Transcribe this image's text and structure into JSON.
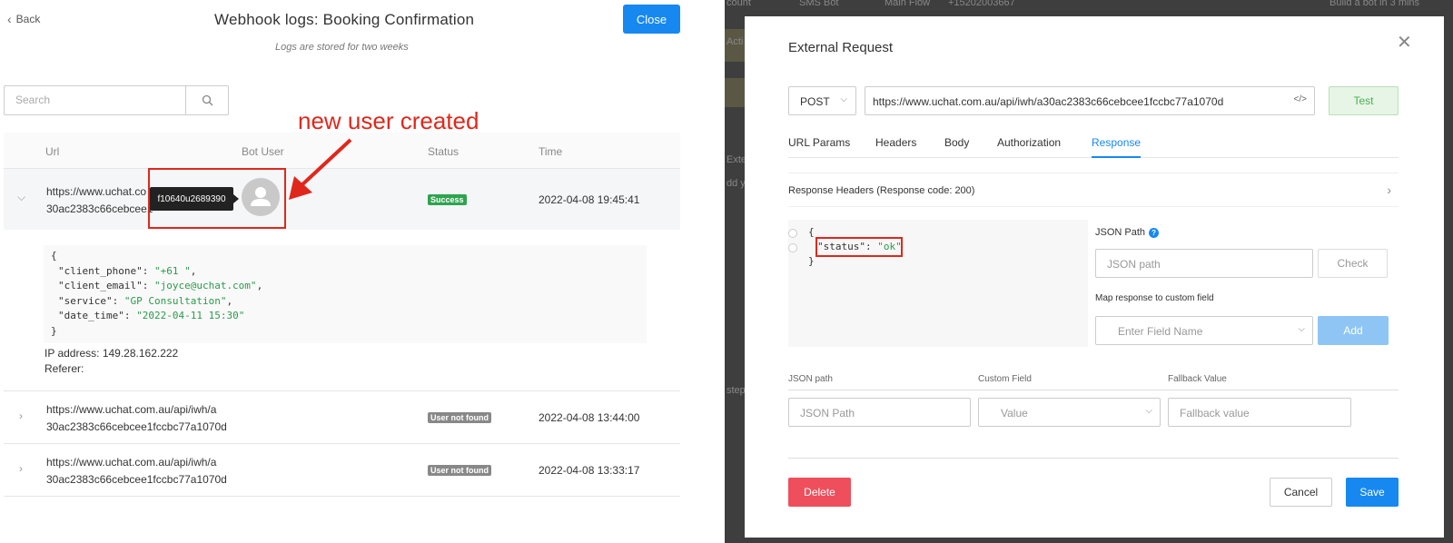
{
  "left": {
    "back_label": "Back",
    "title": "Webhook logs: Booking Confirmation",
    "close_label": "Close",
    "subtitle": "Logs are stored for two weeks",
    "search_placeholder": "Search",
    "annotation": "new user created",
    "columns": [
      "Url",
      "Bot User",
      "Status",
      "Time"
    ],
    "rows": [
      {
        "url_line1": "https://www.uchat.co",
        "url_line2": "30ac2383c66cebcee1",
        "bot_user_tooltip": "f10640u2689390",
        "status": "Success",
        "time": "2022-04-08 19:45:41"
      },
      {
        "url_line1": "https://www.uchat.com.au/api/iwh/a",
        "url_line2": "30ac2383c66cebcee1fccbc77a1070d",
        "status": "User not found",
        "time": "2022-04-08 13:44:00"
      },
      {
        "url_line1": "https://www.uchat.com.au/api/iwh/a",
        "url_line2": "30ac2383c66cebcee1fccbc77a1070d",
        "status": "User not found",
        "time": "2022-04-08 13:33:17"
      }
    ],
    "payload": {
      "open": "{",
      "k1": "\"client_phone\"",
      "v1": "\"+61         \"",
      "k2": "\"client_email\"",
      "v2": "\"joyce@uchat.com\"",
      "k3": "\"service\"",
      "v3": "\"GP Consultation\"",
      "k4": "\"date_time\"",
      "v4": "\"2022-04-11 15:30\"",
      "close": "}"
    },
    "ip_address": "IP address: 149.28.162.222",
    "referer": "Referer:"
  },
  "right": {
    "bg_texts": [
      "count",
      "SMS Bot",
      "Main Flow",
      "+15202003667",
      "Build a bot in 3 mins",
      "Acti",
      "Exte",
      "dd y",
      "step"
    ],
    "title": "External Request",
    "method": "POST",
    "url": "https://www.uchat.com.au/api/iwh/a30ac2383c66cebcee1fccbc77a1070d",
    "code_icon": "</>",
    "test_label": "Test",
    "tabs": [
      "URL Params",
      "Headers",
      "Body",
      "Authorization",
      "Response"
    ],
    "response_headers_label": "Response Headers (Response code: 200)",
    "response_json": {
      "open": "{",
      "key": "\"status\"",
      "value": "\"ok\"",
      "close": "}"
    },
    "json_path_label": "JSON Path",
    "json_path_placeholder": "JSON path",
    "check_label": "Check",
    "map_label": "Map response to custom field",
    "field_name_placeholder": "Enter Field Name",
    "add_label": "Add",
    "columns": [
      "JSON path",
      "Custom Field",
      "Fallback Value"
    ],
    "json_path_input_placeholder": "JSON Path",
    "value_placeholder": "Value",
    "fallback_placeholder": "Fallback value",
    "delete_label": "Delete",
    "cancel_label": "Cancel",
    "save_label": "Save"
  },
  "colors": {
    "primary": "#1688f0",
    "success": "#2ea44f",
    "danger": "#ef4e5c",
    "annotation_red": "#e0271c"
  }
}
